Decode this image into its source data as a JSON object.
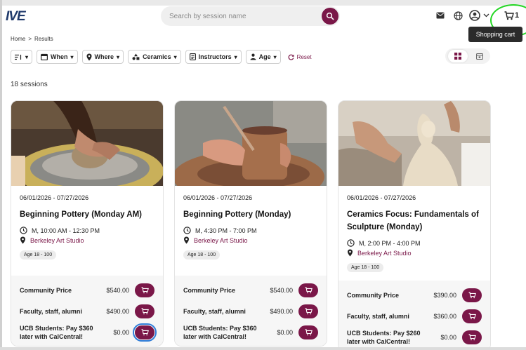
{
  "header": {
    "logo": "IVE",
    "search_placeholder": "Search by session name",
    "cart_count": "1",
    "tooltip": "Shopping cart"
  },
  "breadcrumb": {
    "home": "Home",
    "sep": ">",
    "current": "Results"
  },
  "filters": {
    "when": "When",
    "where": "Where",
    "ceramics": "Ceramics",
    "instructors": "Instructors",
    "age": "Age",
    "reset": "Reset"
  },
  "results": {
    "count_text": "18 sessions"
  },
  "cards": [
    {
      "dates": "06/01/2026 - 07/27/2026",
      "title": "Beginning Pottery (Monday AM)",
      "time": "M, 10:00 AM - 12:30 PM",
      "location": "Berkeley Art Studio",
      "age": "Age 18 - 100",
      "prices": [
        {
          "name": "Community Price",
          "value": "$540.00"
        },
        {
          "name": "Faculty, staff, alumni",
          "value": "$490.00"
        },
        {
          "name": "UCB Students: Pay $360 later with CalCentral!",
          "value": "$0.00"
        }
      ]
    },
    {
      "dates": "06/01/2026 - 07/27/2026",
      "title": "Beginning Pottery (Monday)",
      "time": "M, 4:30 PM - 7:00 PM",
      "location": "Berkeley Art Studio",
      "age": "Age 18 - 100",
      "prices": [
        {
          "name": "Community Price",
          "value": "$540.00"
        },
        {
          "name": "Faculty, staff, alumni",
          "value": "$490.00"
        },
        {
          "name": "UCB Students: Pay $360 later with CalCentral!",
          "value": "$0.00"
        }
      ]
    },
    {
      "dates": "06/01/2026 - 07/27/2026",
      "title": "Ceramics Focus: Fundamentals of Sculpture (Monday)",
      "time": "M, 2:00 PM - 4:00 PM",
      "location": "Berkeley Art Studio",
      "age": "Age 18 - 100",
      "prices": [
        {
          "name": "Community Price",
          "value": "$390.00"
        },
        {
          "name": "Faculty, staff, alumni",
          "value": "$360.00"
        },
        {
          "name": "UCB Students: Pay $260 later with CalCentral!",
          "value": "$0.00"
        }
      ]
    }
  ],
  "colors": {
    "brand": "#7a1748",
    "focus_ring": "#2f7dd8",
    "highlight_ring": "#22d622"
  }
}
